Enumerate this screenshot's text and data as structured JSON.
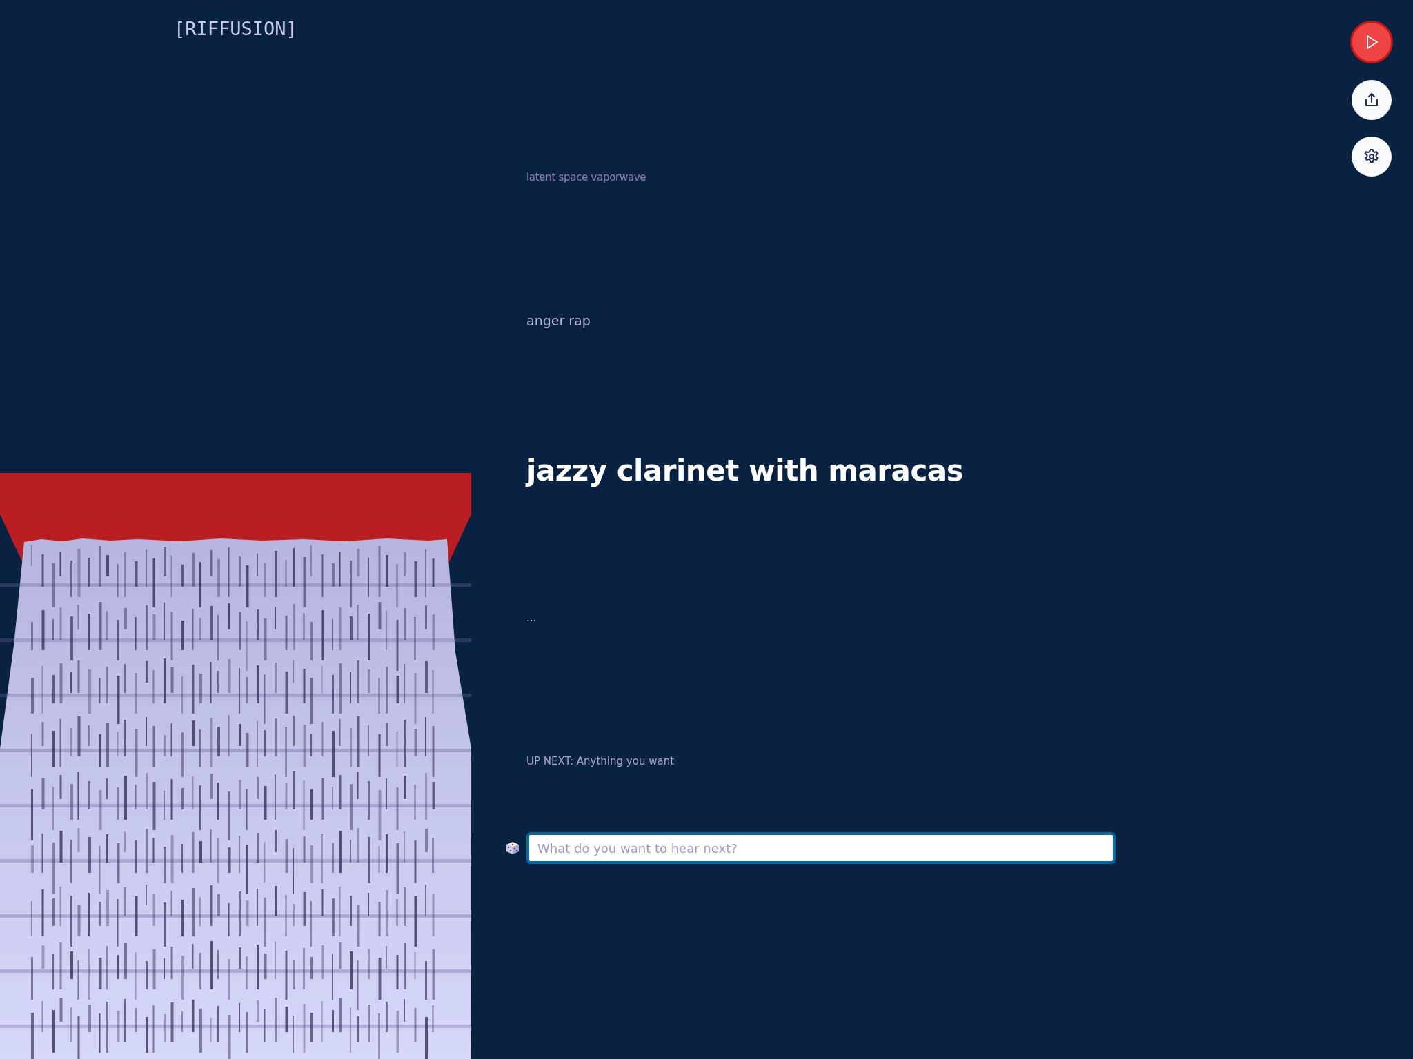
{
  "logo": "[RIFFUSION]",
  "prompts": [
    {
      "text": "latent space vaporwave",
      "kind": "past"
    },
    {
      "text": "anger rap",
      "kind": "previous"
    },
    {
      "text": "jazzy clarinet with maracas",
      "kind": "current"
    },
    {
      "text": "...",
      "kind": "next"
    },
    {
      "text": "UP NEXT: Anything you want",
      "kind": "upnext"
    }
  ],
  "prompt_input": {
    "placeholder": "What do you want to hear next?"
  }
}
